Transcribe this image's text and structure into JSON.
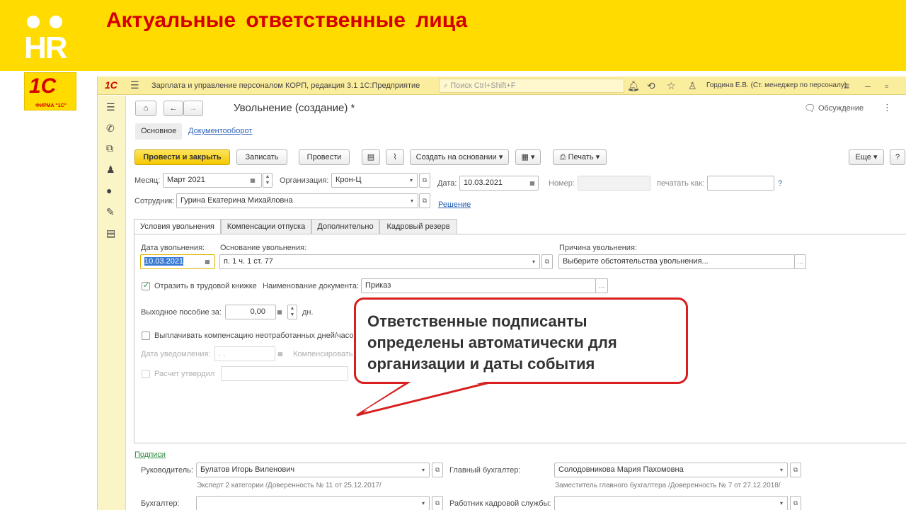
{
  "slide": {
    "title": "Актуальные ответственные лица",
    "hr_logo": "HR",
    "c1_logo": "1С",
    "c1_sub": "ФИРМА \"1С\""
  },
  "app": {
    "logo": "1С",
    "title": "Зарплата и управление персоналом КОРП, редакция 3.1 1С:Предприятие",
    "search_placeholder": "Поиск Ctrl+Shift+F",
    "user": "Гордина Е.В. (Ст. менеджер по персоналу)"
  },
  "form": {
    "title": "Увольнение (создание) *",
    "discussion": "Обсуждение",
    "nav_tabs": [
      "Основное",
      "Документооборот"
    ],
    "buttons": {
      "post_close": "Провести и закрыть",
      "save": "Записать",
      "post": "Провести",
      "create_based": "Создать на основании",
      "print": "Печать",
      "more": "Еще",
      "help": "?"
    },
    "fields": {
      "month_label": "Месяц:",
      "month_value": "Март 2021",
      "org_label": "Организация:",
      "org_value": "Крон-Ц",
      "date_label": "Дата:",
      "date_value": "10.03.2021",
      "number_label": "Номер:",
      "number_value": "",
      "print_as_label": "печатать как:",
      "print_as_value": "",
      "employee_label": "Сотрудник:",
      "employee_value": "Гурина Екатерина Михайловна",
      "decision_link": "Решение"
    },
    "tabs": [
      "Условия увольнения",
      "Компенсации отпуска",
      "Дополнительно",
      "Кадровый резерв"
    ],
    "conditions": {
      "dismissal_date_label": "Дата увольнения:",
      "dismissal_date_value": "10.03.2021",
      "basis_label": "Основание увольнения:",
      "basis_value": "п. 1 ч. 1 ст. 77",
      "reason_label": "Причина увольнения:",
      "reason_value": "Выберите обстоятельства увольнения...",
      "workbook_check": "Отразить в трудовой книжке",
      "doc_name_label": "Наименование документа:",
      "doc_name_value": "Приказ",
      "severance_label": "Выходное пособие за:",
      "severance_value": "0,00",
      "severance_unit": "дн.",
      "comp_check": "Выплачивать компенсацию неотработанных дней/часов",
      "notice_date_label": "Дата уведомления:",
      "notice_date_value": ". .",
      "compensate_label": "Компенсировать",
      "calc_approved_check": "Расчет утвердил"
    },
    "signatures": {
      "link": "Подписи",
      "head_label": "Руководитель:",
      "head_value": "Булатов Игорь Виленович",
      "head_sub": "Эксперт 2 категории /Доверенность № 11  от 25.12.2017/",
      "chief_acc_label": "Главный бухгалтер:",
      "chief_acc_value": "Солодовникова Мария Пахомовна",
      "chief_acc_sub": "Заместитель главного бухгалтера  /Доверенность № 7 от 27.12.2018/",
      "acc_label": "Бухгалтер:",
      "acc_value": "",
      "hr_label": "Работник кадровой службы:",
      "hr_value": ""
    }
  },
  "callout": {
    "text": "Ответственные подписанты определены автоматически для организации и даты события"
  },
  "colors": {
    "banner": "#ffdb00",
    "title_red": "#d40000",
    "primary_button": "#f5c800",
    "callout_border": "#d81e1e"
  }
}
